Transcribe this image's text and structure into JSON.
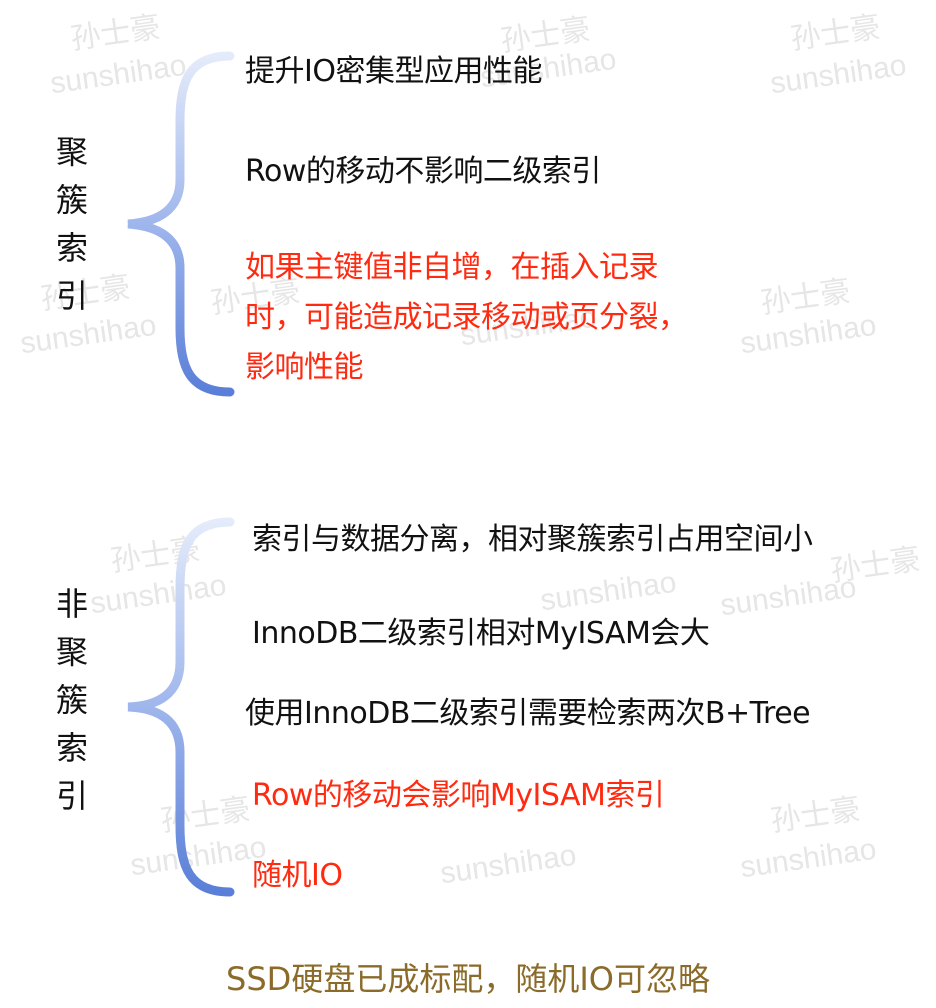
{
  "watermarks": [
    "孙士豪",
    "孙士豪",
    "孙士豪",
    "sunshihao",
    "sunshihao",
    "sunshihao",
    "孙士豪",
    "孙士豪",
    "孙士豪",
    "sunshihao",
    "sunshihao",
    "sunshihao",
    "孙士豪",
    "孙士豪",
    "sunshihao",
    "sunshihao",
    "sunshihao",
    "孙士豪",
    "孙士豪",
    "sunshihao",
    "sunshihao",
    "sunshihao"
  ],
  "clustered": {
    "label_chars": [
      "聚",
      "簇",
      "索",
      "引"
    ],
    "items": [
      {
        "text": "提升IO密集型应用性能",
        "color": "#111111"
      },
      {
        "text": "Row的移动不影响二级索引",
        "color": "#111111"
      },
      {
        "text": "如果主键值非自增，在插入记录时，可能造成记录移动或页分裂，影响性能",
        "color": "#ff2a10"
      }
    ]
  },
  "nonclustered": {
    "label_chars": [
      "非",
      "聚",
      "簇",
      "索",
      "引"
    ],
    "items": [
      {
        "text": "索引与数据分离，相对聚簇索引占用空间小",
        "color": "#111111"
      },
      {
        "text": "InnoDB二级索引相对MyISAM会大",
        "color": "#111111"
      },
      {
        "text": "使用InnoDB二级索引需要检索两次B+Tree",
        "color": "#111111"
      },
      {
        "text": "Row的移动会影响MyISAM索引",
        "color": "#ff2a10"
      },
      {
        "text": "随机IO",
        "color": "#ff2a10"
      }
    ]
  },
  "footer": "SSD硬盘已成标配，随机IO可忽略",
  "colors": {
    "text": "#111111",
    "highlight": "#ff2a10",
    "footer": "#8b6b2a",
    "brace_top": "#b8c8f0",
    "brace_bottom": "#5a7fd8"
  }
}
